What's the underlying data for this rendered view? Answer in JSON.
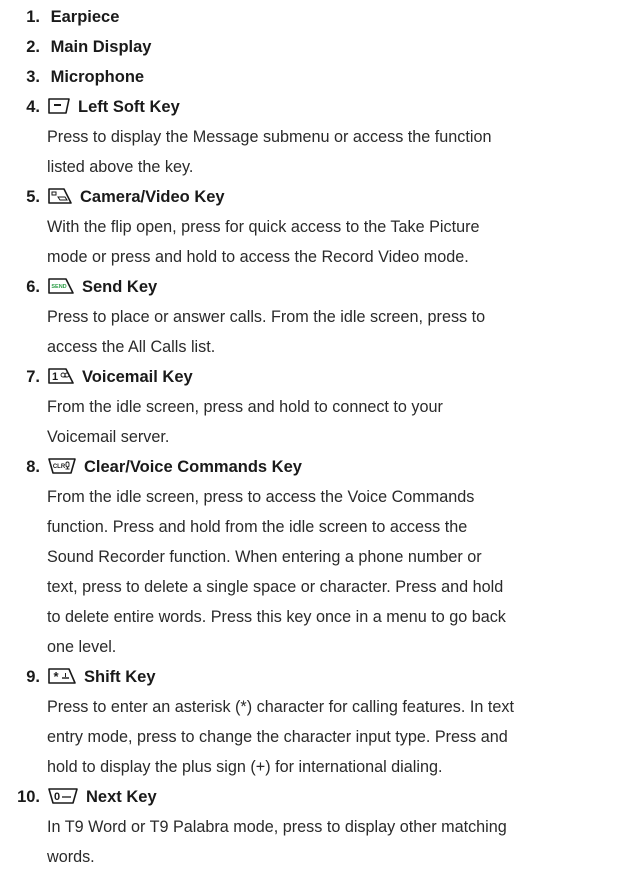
{
  "items": [
    {
      "number": "1.",
      "title": "Earpiece"
    },
    {
      "number": "2.",
      "title": "Main Display"
    },
    {
      "number": "3.",
      "title": "Microphone"
    },
    {
      "number": "4.",
      "title": "Left Soft Key",
      "icon": "left-soft-key-icon",
      "desc": [
        "Press to display the Message submenu or access the function",
        "listed above the key."
      ]
    },
    {
      "number": "5.",
      "title": "Camera/Video Key",
      "icon": "camera-key-icon",
      "desc": [
        "With the flip open, press for quick access to the Take Picture",
        "mode or press and hold to access the Record Video mode."
      ]
    },
    {
      "number": "6.",
      "title": "Send Key",
      "icon": "send-key-icon",
      "icon_text": "SEND",
      "desc": [
        "Press to place or answer calls. From the idle screen, press to",
        "access the All Calls list."
      ]
    },
    {
      "number": "7.",
      "title": "Voicemail Key",
      "icon": "voicemail-key-icon",
      "icon_text": "1",
      "desc": [
        "From the idle screen, press and hold to connect to your",
        "Voicemail server."
      ]
    },
    {
      "number": "8.",
      "title": "Clear/Voice Commands Key",
      "icon": "clear-key-icon",
      "icon_text": "CLR",
      "desc": [
        "From the idle screen, press to access the Voice Commands",
        "function. Press and hold from the idle screen to access the",
        "Sound Recorder function. When entering a phone number or",
        "text, press to delete a single space or character. Press and hold",
        "to delete entire words. Press this key once in a menu to go back",
        "one level."
      ]
    },
    {
      "number": "9.",
      "title": "Shift Key",
      "icon": "shift-key-icon",
      "icon_text": "*",
      "desc": [
        "Press to enter an asterisk (*) character for calling features. In text",
        "entry mode, press to change the character input type. Press and",
        "hold to display the plus sign (+) for international dialing."
      ]
    },
    {
      "number": "10.",
      "title": "Next Key",
      "icon": "next-key-icon",
      "icon_text": "0",
      "desc": [
        "In T9 Word or T9 Palabra mode, press to display other matching",
        "words."
      ]
    }
  ]
}
